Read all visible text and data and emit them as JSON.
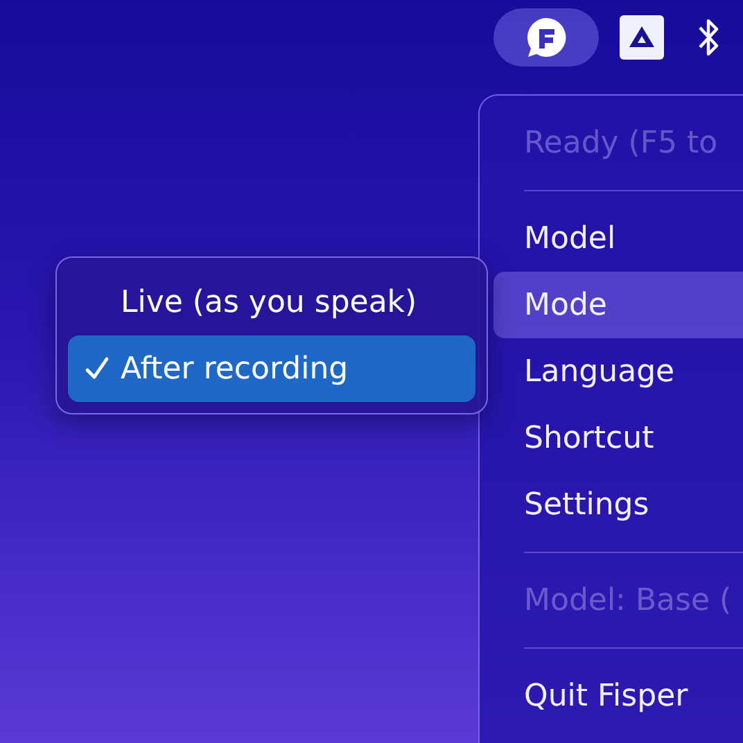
{
  "menu_bar": {
    "items": [
      {
        "kind": "app",
        "selected": true
      },
      {
        "kind": "drive",
        "selected": false
      },
      {
        "kind": "bluetooth",
        "selected": false
      }
    ]
  },
  "menu": {
    "items": [
      {
        "kind": "status",
        "label": "Ready (F5 to"
      },
      {
        "kind": "separator"
      },
      {
        "kind": "item",
        "label": "Model",
        "selected": false
      },
      {
        "kind": "item",
        "label": "Mode",
        "selected": true
      },
      {
        "kind": "item",
        "label": "Language",
        "selected": false
      },
      {
        "kind": "item",
        "label": "Shortcut",
        "selected": false
      },
      {
        "kind": "item",
        "label": "Settings",
        "selected": false
      },
      {
        "kind": "separator"
      },
      {
        "kind": "status",
        "label": "Model: Base ("
      },
      {
        "kind": "separator"
      },
      {
        "kind": "item",
        "label": "Quit Fisper",
        "selected": false
      }
    ]
  },
  "submenu": {
    "items": [
      {
        "label": "Live (as you speak)",
        "checked": false,
        "selected": false
      },
      {
        "label": "After recording",
        "checked": true,
        "selected": true
      }
    ]
  }
}
